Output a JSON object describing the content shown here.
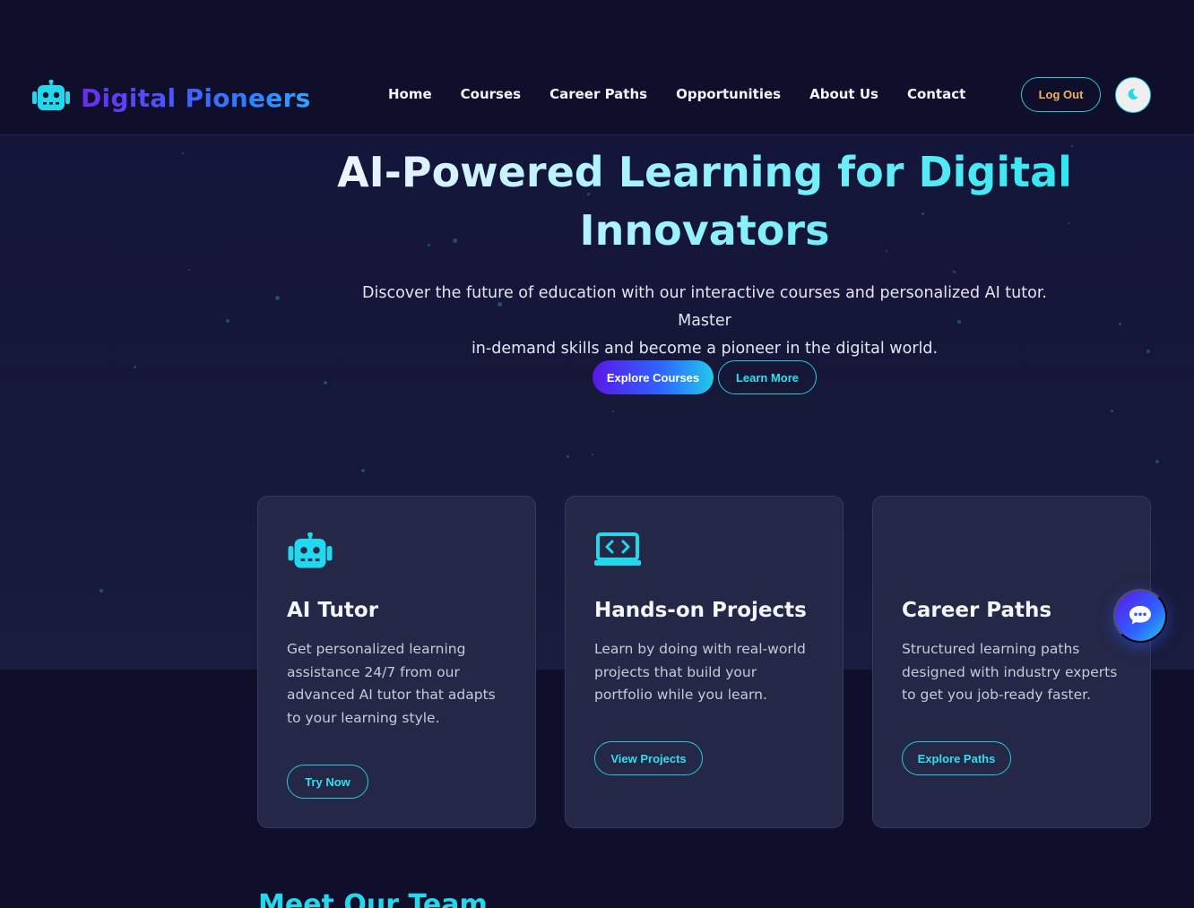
{
  "brand": {
    "name": "Digital Pioneers",
    "logo_icon": "robot-icon"
  },
  "nav": {
    "items": [
      {
        "label": "Home"
      },
      {
        "label": "Courses"
      },
      {
        "label": "Career Paths"
      },
      {
        "label": "Opportunities"
      },
      {
        "label": "About Us"
      },
      {
        "label": "Contact"
      }
    ]
  },
  "header_actions": {
    "logout_label": "Log Out",
    "theme_icon": "moon-icon"
  },
  "hero": {
    "title_line1": "AI-Powered Learning for Digital",
    "title_line2": "Innovators",
    "subtitle_line1": "Discover the future of education with our interactive courses and personalized AI tutor. Master",
    "subtitle_line2": "in-demand skills and become a pioneer in the digital world.",
    "primary_cta": "Explore Courses",
    "secondary_cta": "Learn More"
  },
  "features": [
    {
      "icon": "robot-icon",
      "title": "AI Tutor",
      "description": "Get personalized learning assistance 24/7 from our advanced AI tutor that adapts to your learning style.",
      "button": "Try Now"
    },
    {
      "icon": "laptop-code-icon",
      "title": "Hands-on Projects",
      "description": "Learn by doing with real-world projects that build your portfolio while you learn.",
      "button": "View Projects"
    },
    {
      "icon": "",
      "title": "Career Paths",
      "description": "Structured learning paths designed with industry experts to get you job-ready faster.",
      "button": "Explore Paths"
    }
  ],
  "chat": {
    "icon": "chat-bubble-icon"
  },
  "team": {
    "heading": "Meet Our Team"
  },
  "colors": {
    "background": "#0f0e2b",
    "accent_cyan": "#22c9d8",
    "accent_purple": "#5b17e6",
    "accent_blue": "#2f62ff",
    "logout_text": "#f0b35c",
    "card_bg": "#252746"
  }
}
